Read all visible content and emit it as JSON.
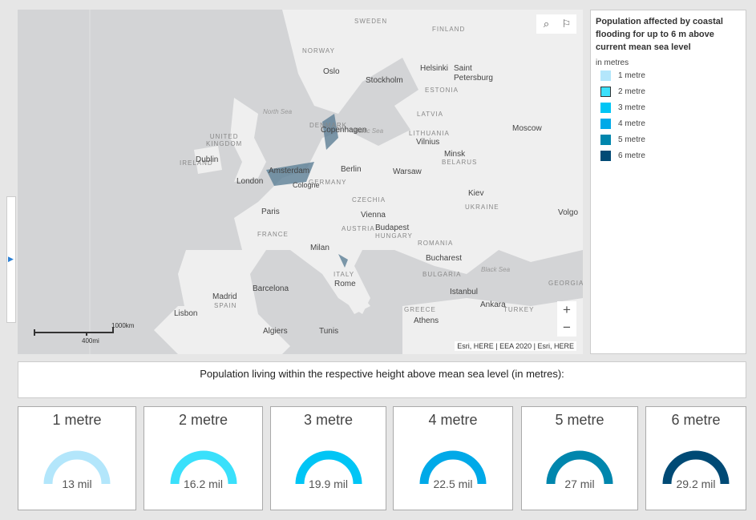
{
  "map": {
    "labels": {
      "sweden": "SWEDEN",
      "finland": "FINLAND",
      "norway": "NORWAY",
      "oslo": "Oslo",
      "stockholm": "Stockholm",
      "helsinki": "Helsinki",
      "saint_petersburg": "Saint\nPetersburg",
      "estonia": "ESTONIA",
      "latvia": "LATVIA",
      "north_sea": "North Sea",
      "baltic_sea": "Baltic Sea",
      "denmark": "DENMARK",
      "copenhagen": "Copenhagen",
      "lithuania": "LITHUANIA",
      "vilnius": "Vilnius",
      "moscow": "Moscow",
      "minsk": "Minsk",
      "belarus": "BELARUS",
      "uk": "UNITED\nKINGDOM",
      "ireland": "IRELAND",
      "dublin": "Dublin",
      "amsterdam": "Amsterdam",
      "berlin": "Berlin",
      "warsaw": "Warsaw",
      "london": "London",
      "cologne": "Cologne",
      "germany": "GERMANY",
      "czechia": "CZECHIA",
      "kiev": "Kiev",
      "ukraine": "UKRAINE",
      "volgograd": "Volgo",
      "paris": "Paris",
      "vienna": "Vienna",
      "austria": "AUSTRIA",
      "budapest": "Budapest",
      "hungary": "HUNGARY",
      "france": "FRANCE",
      "romania": "ROMANIA",
      "milan": "Milan",
      "bucharest": "Bucharest",
      "black_sea": "Black Sea",
      "italy": "ITALY",
      "rome": "Rome",
      "bulgaria": "BULGARIA",
      "georgia": "GEORGIA",
      "barcelona": "Barcelona",
      "madrid": "Madrid",
      "spain": "SPAIN",
      "istanbul": "Istanbul",
      "lisbon": "Lisbon",
      "greece": "GREECE",
      "ankara": "Ankara",
      "turkey": "TURKEY",
      "athens": "Athens",
      "algiers": "Algiers",
      "tunis": "Tunis"
    },
    "search_icon": "search-icon",
    "bookmark_icon": "bookmark-icon",
    "zoom_in": "+",
    "zoom_out": "−",
    "attribution": "Esri, HERE | EEA 2020 | Esri, HERE",
    "scale_km": "1000km",
    "scale_mi": "400mi"
  },
  "legend": {
    "title": "Population affected by coastal flooding for up to 6 m above current mean sea level",
    "unit": "in metres",
    "items": [
      {
        "label": "1 metre",
        "color": "#b3e6fb"
      },
      {
        "label": "2 metre",
        "color": "#3ae0fb"
      },
      {
        "label": "3 metre",
        "color": "#00c5f5"
      },
      {
        "label": "4 metre",
        "color": "#00a9e8"
      },
      {
        "label": "5 metre",
        "color": "#0086ad"
      },
      {
        "label": "6 metre",
        "color": "#004a75"
      }
    ]
  },
  "summary_title": "Population living within the respective height above mean sea level (in metres):",
  "gauges": [
    {
      "title": "1 metre",
      "value": "13 mil",
      "color": "#b3e6fb"
    },
    {
      "title": "2 metre",
      "value": "16.2 mil",
      "color": "#3ae0fb"
    },
    {
      "title": "3 metre",
      "value": "19.9 mil",
      "color": "#00c5f5"
    },
    {
      "title": "4 metre",
      "value": "22.5 mil",
      "color": "#00a9e8"
    },
    {
      "title": "5 metre",
      "value": "27 mil",
      "color": "#0086ad"
    },
    {
      "title": "6 metre",
      "value": "29.2 mil",
      "color": "#004a75"
    }
  ]
}
